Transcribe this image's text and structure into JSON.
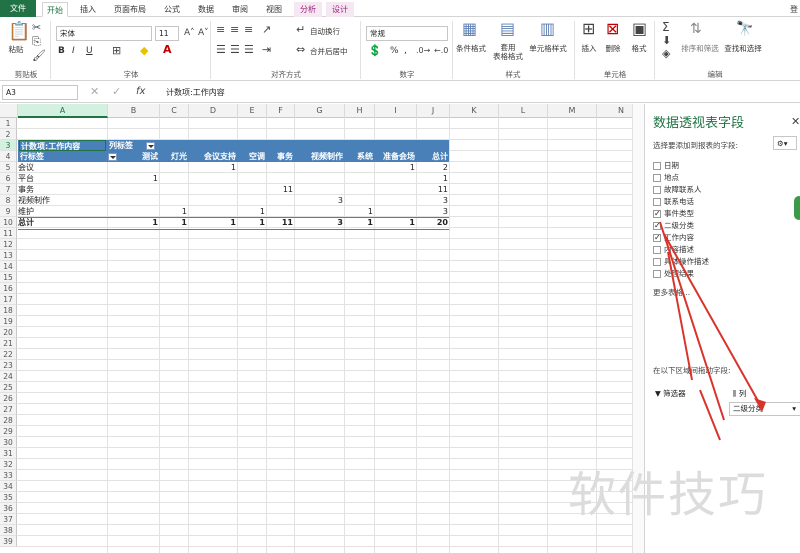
{
  "ribbon_tabs": [
    "文件",
    "开始",
    "插入",
    "页面布局",
    "公式",
    "数据",
    "审阅",
    "视图",
    "分析",
    "设计"
  ],
  "account_label": "登",
  "clipboard": {
    "paste": "粘贴",
    "group": "剪贴板"
  },
  "font": {
    "name": "宋体",
    "size": "11",
    "group": "字体",
    "bold": "B",
    "italic": "I",
    "underline": "U"
  },
  "alignment": {
    "wrap": "自动换行",
    "merge": "合并后居中",
    "group": "对齐方式"
  },
  "number": {
    "format": "常规",
    "percent": "%",
    "comma": ",",
    "group": "数字"
  },
  "styles": {
    "conditional": "条件格式",
    "table": "套用\n表格格式",
    "cell": "单元格样式",
    "group": "样式"
  },
  "cells": {
    "insert": "插入",
    "delete": "删除",
    "format": "格式",
    "group": "单元格"
  },
  "editing": {
    "sort": "排序和筛选",
    "find": "查找和选择",
    "group": "编辑"
  },
  "formula_bar": {
    "namebox": "A3",
    "fx": "fx",
    "content": "计数项:工作内容"
  },
  "columns": [
    "A",
    "B",
    "C",
    "D",
    "E",
    "F",
    "G",
    "H",
    "I",
    "J",
    "K",
    "L",
    "M",
    "N"
  ],
  "rows": [
    "1",
    "2",
    "3",
    "4",
    "5",
    "6",
    "7",
    "8",
    "9",
    "10",
    "11",
    "12",
    "13",
    "14",
    "15",
    "16",
    "17",
    "18",
    "19",
    "20",
    "21",
    "22",
    "23",
    "24",
    "25",
    "26",
    "27",
    "28",
    "29",
    "30",
    "31",
    "32",
    "33",
    "34",
    "35",
    "36",
    "37",
    "38",
    "39"
  ],
  "pivot": {
    "title_cell": "计数项:工作内容",
    "col_label": "列标签",
    "row_label": "行标签",
    "col_headers": [
      "测试",
      "灯光",
      "会议支持",
      "空调",
      "事务",
      "视频制作",
      "系统",
      "准备会场",
      "总计"
    ],
    "rows": [
      {
        "label": "会议",
        "values": [
          "",
          "",
          "1",
          "",
          "",
          "",
          "",
          "1",
          "2"
        ]
      },
      {
        "label": "平台",
        "values": [
          "1",
          "",
          "",
          "",
          "",
          "",
          "",
          "",
          "1"
        ]
      },
      {
        "label": "事务",
        "values": [
          "",
          "",
          "",
          "",
          "11",
          "",
          "",
          "",
          "11"
        ]
      },
      {
        "label": "视频制作",
        "values": [
          "",
          "",
          "",
          "",
          "",
          "3",
          "",
          "",
          "3"
        ]
      },
      {
        "label": "维护",
        "values": [
          "",
          "1",
          "",
          "1",
          "",
          "",
          "1",
          "",
          "3"
        ]
      }
    ],
    "total": {
      "label": "总计",
      "values": [
        "1",
        "1",
        "1",
        "1",
        "11",
        "3",
        "1",
        "1",
        "20"
      ]
    }
  },
  "pane": {
    "title": "数据透视表字段",
    "subtitle": "选择要添加到报表的字段:",
    "fields": [
      {
        "name": "日期",
        "checked": false
      },
      {
        "name": "地点",
        "checked": false
      },
      {
        "name": "故障联系人",
        "checked": false
      },
      {
        "name": "联系电话",
        "checked": false
      },
      {
        "name": "事件类型",
        "checked": true
      },
      {
        "name": "二级分类",
        "checked": true
      },
      {
        "name": "工作内容",
        "checked": true
      },
      {
        "name": "内容描述",
        "checked": false
      },
      {
        "name": "具体操作描述",
        "checked": false
      },
      {
        "name": "处理结果",
        "checked": false
      }
    ],
    "more_tables": "更多表格...",
    "drag_hint": "在以下区域间拖动字段:",
    "filters": "筛选器",
    "columns": "列",
    "column_item": "二级分类"
  },
  "watermark": "软件技巧",
  "colors": {
    "accent": "#217346",
    "pivot_header": "#4a80b8",
    "arrow": "#d9342b"
  }
}
